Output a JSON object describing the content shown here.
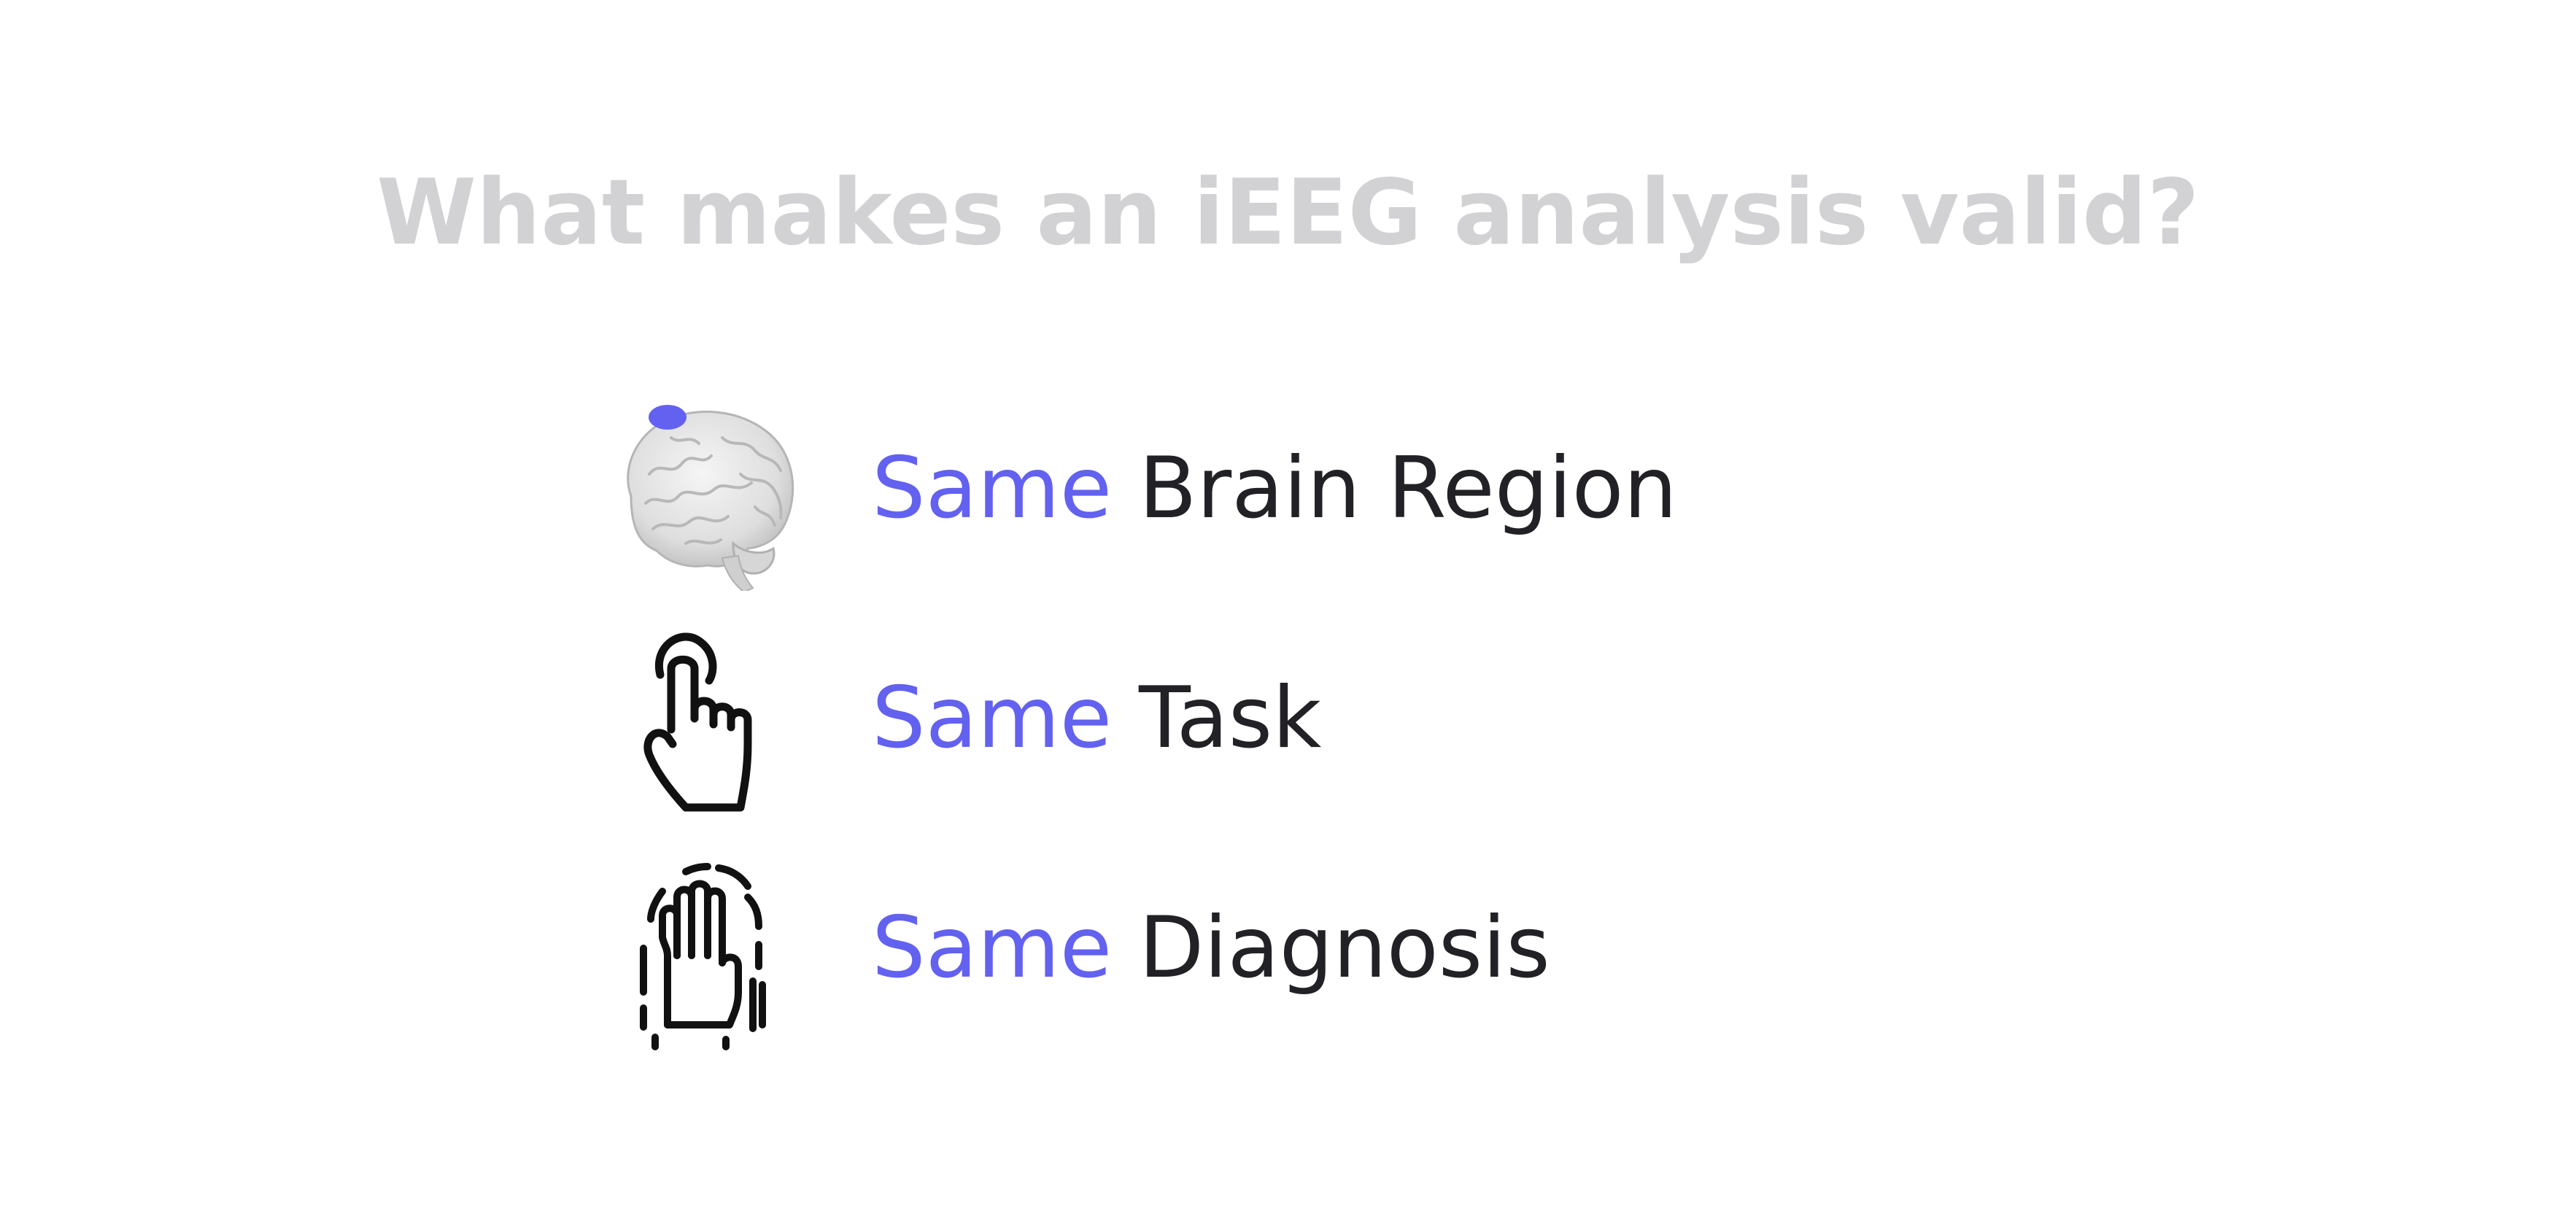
{
  "title": "What makes an iEEG analysis valid?",
  "colors": {
    "title": "#d2d2d4",
    "accent": "#6361f0",
    "text": "#222126"
  },
  "items": [
    {
      "icon": "brain-icon",
      "accent_word": "Same",
      "rest": "Brain Region"
    },
    {
      "icon": "pointing-hand-icon",
      "accent_word": "Same",
      "rest": "Task"
    },
    {
      "icon": "shaking-hand-icon",
      "accent_word": "Same",
      "rest": "Diagnosis"
    }
  ]
}
